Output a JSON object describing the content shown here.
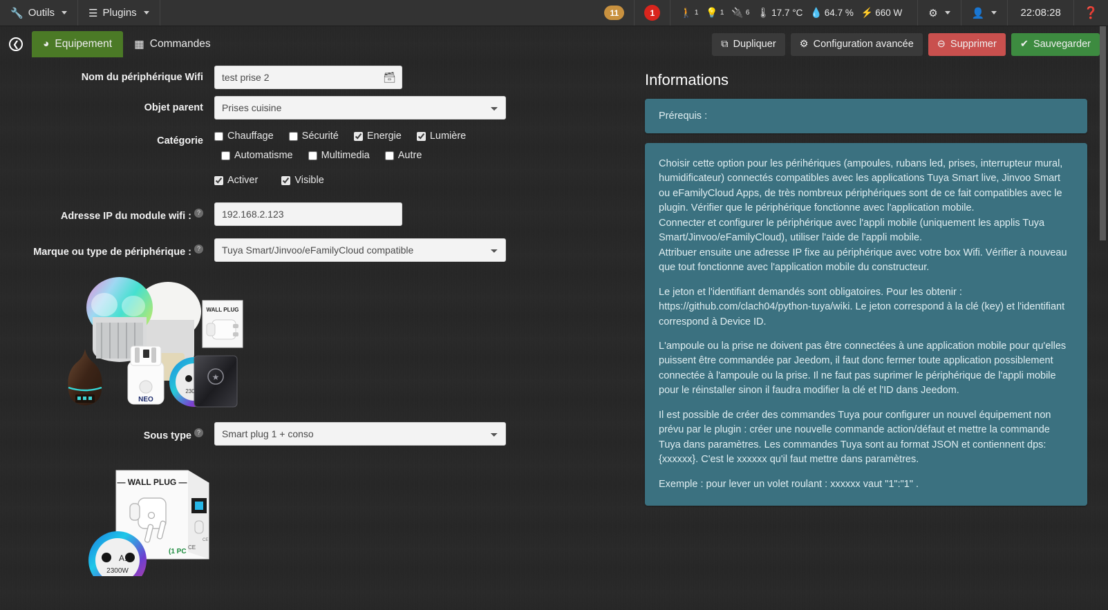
{
  "topbar": {
    "menus": [
      {
        "label": "Outils",
        "icon": "wrench-icon"
      },
      {
        "label": "Plugins",
        "icon": "list-icon"
      }
    ],
    "badge_message": "11",
    "badge_alert": "1",
    "summary": {
      "people_icon": "person-walking-icon",
      "people_count": "1",
      "light_icon": "lightbulb-icon",
      "light_count": "1",
      "plug_icon": "plug-icon",
      "plug_count": "6",
      "temp_icon": "thermometer-icon",
      "temp_value": "17.7 °C",
      "humidity_icon": "droplet-icon",
      "humidity_value": "64.7 %",
      "power_icon": "bolt-icon",
      "power_value": "660 W"
    },
    "gear_icon": "gears-icon",
    "user_icon": "user-icon",
    "clock": "22:08:28",
    "help_icon": "question-circle-icon"
  },
  "actionbar": {
    "back_icon": "back-arrow-icon",
    "tabs": [
      {
        "label": "Equipement",
        "icon": "dashboard-icon",
        "active": true
      },
      {
        "label": "Commandes",
        "icon": "table-icon",
        "active": false
      }
    ],
    "buttons": [
      {
        "label": "Dupliquer",
        "icon": "copy-icon",
        "style": "default"
      },
      {
        "label": "Configuration avancée",
        "icon": "gears-icon",
        "style": "default"
      },
      {
        "label": "Supprimer",
        "icon": "minus-circle-icon",
        "style": "danger"
      },
      {
        "label": "Sauvegarder",
        "icon": "check-circle-icon",
        "style": "success"
      }
    ]
  },
  "form": {
    "name_label": "Nom du périphérique Wifi",
    "name_value": "test prise 2",
    "name_addon_icon": "id-card-icon",
    "parent_label": "Objet parent",
    "parent_value": "Prises cuisine",
    "category_label": "Catégorie",
    "categories": [
      {
        "label": "Chauffage",
        "checked": false
      },
      {
        "label": "Sécurité",
        "checked": false
      },
      {
        "label": "Energie",
        "checked": true
      },
      {
        "label": "Lumière",
        "checked": true
      },
      {
        "label": "Automatisme",
        "checked": false
      },
      {
        "label": "Multimedia",
        "checked": false
      },
      {
        "label": "Autre",
        "checked": false
      }
    ],
    "flags": [
      {
        "label": "Activer",
        "checked": true
      },
      {
        "label": "Visible",
        "checked": true
      }
    ],
    "ip_label": "Adresse IP du module wifi :",
    "ip_value": "192.168.2.123",
    "brand_label": "Marque ou type de périphérique :",
    "brand_value": "Tuya Smart/Jinvoo/eFamilyCloud compatible",
    "subtype_label": "Sous type",
    "subtype_value": "Smart plug 1 + conso",
    "help_icon": "question-mark-icon",
    "image1_alt": "tuya-compatible-devices-photo",
    "image2_alt": "wall-plug-box-photo"
  },
  "info": {
    "title": "Informations",
    "prereq_label": "Prérequis :",
    "paragraphs": [
      "Choisir cette option pour les périhériques (ampoules, rubans led, prises, interrupteur mural, humidificateur) connectés compatibles avec les applications Tuya Smart live, Jinvoo Smart ou eFamilyCloud Apps, de très nombreux périphériques sont de ce fait compatibles avec le plugin. Vérifier que le périphérique fonctionne avec l'application mobile.\nConnecter et configurer le périphérique avec l'appli mobile (uniquement les applis Tuya Smart/Jinvoo/eFamilyCloud), utiliser l'aide de l'appli mobile.\nAttribuer ensuite une adresse IP fixe au périphérique avec votre box Wifi. Vérifier à nouveau que tout fonctionne avec l'application mobile du constructeur.",
      "Le jeton et l'identifiant demandés sont obligatoires. Pour les obtenir : https://github.com/clach04/python-tuya/wiki. Le jeton correspond à la clé (key) et l'identifiant correspond à Device ID.",
      "L'ampoule ou la prise ne doivent pas être connectées à une application mobile pour qu'elles puissent être commandée par Jeedom, il faut donc fermer toute application possiblement connectée à l'ampoule ou la prise. Il ne faut pas suprimer le périphérique de l'appli mobile pour le réinstaller sinon il faudra modifier la clé et l'ID dans Jeedom.",
      "Il est possible de créer des commandes Tuya pour configurer un nouvel équipement non prévu par le plugin : créer une nouvelle commande action/défaut et mettre la commande Tuya dans paramètres. Les commandes Tuya sont au format JSON et contiennent dps:{xxxxxx}. C'est le xxxxxx qu'il faut mettre dans paramètres.",
      "Exemple : pour lever un volet roulant : xxxxxx vaut \"1\":\"1\" ."
    ]
  },
  "colors": {
    "background": "#272727",
    "topbar": "#333333",
    "accent_green": "#4b7a26",
    "danger_red": "#c9504e",
    "success_green": "#3d8b40",
    "panel_blue": "#3b7180",
    "badge_orange": "#c8913f",
    "badge_red": "#d9251d"
  }
}
